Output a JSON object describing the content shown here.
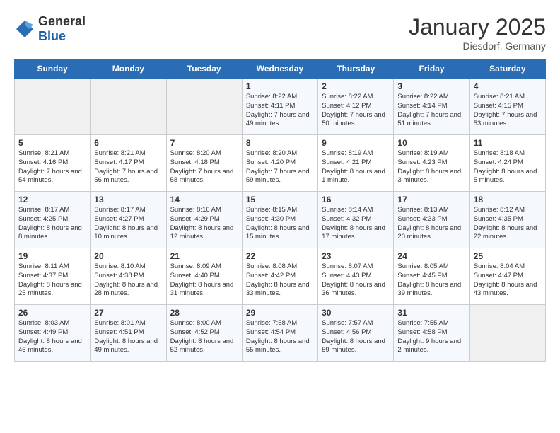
{
  "header": {
    "logo_general": "General",
    "logo_blue": "Blue",
    "title": "January 2025",
    "subtitle": "Diesdorf, Germany"
  },
  "days_of_week": [
    "Sunday",
    "Monday",
    "Tuesday",
    "Wednesday",
    "Thursday",
    "Friday",
    "Saturday"
  ],
  "weeks": [
    [
      {
        "day": "",
        "content": ""
      },
      {
        "day": "",
        "content": ""
      },
      {
        "day": "",
        "content": ""
      },
      {
        "day": "1",
        "content": "Sunrise: 8:22 AM\nSunset: 4:11 PM\nDaylight: 7 hours and 49 minutes."
      },
      {
        "day": "2",
        "content": "Sunrise: 8:22 AM\nSunset: 4:12 PM\nDaylight: 7 hours and 50 minutes."
      },
      {
        "day": "3",
        "content": "Sunrise: 8:22 AM\nSunset: 4:14 PM\nDaylight: 7 hours and 51 minutes."
      },
      {
        "day": "4",
        "content": "Sunrise: 8:21 AM\nSunset: 4:15 PM\nDaylight: 7 hours and 53 minutes."
      }
    ],
    [
      {
        "day": "5",
        "content": "Sunrise: 8:21 AM\nSunset: 4:16 PM\nDaylight: 7 hours and 54 minutes."
      },
      {
        "day": "6",
        "content": "Sunrise: 8:21 AM\nSunset: 4:17 PM\nDaylight: 7 hours and 56 minutes."
      },
      {
        "day": "7",
        "content": "Sunrise: 8:20 AM\nSunset: 4:18 PM\nDaylight: 7 hours and 58 minutes."
      },
      {
        "day": "8",
        "content": "Sunrise: 8:20 AM\nSunset: 4:20 PM\nDaylight: 7 hours and 59 minutes."
      },
      {
        "day": "9",
        "content": "Sunrise: 8:19 AM\nSunset: 4:21 PM\nDaylight: 8 hours and 1 minute."
      },
      {
        "day": "10",
        "content": "Sunrise: 8:19 AM\nSunset: 4:23 PM\nDaylight: 8 hours and 3 minutes."
      },
      {
        "day": "11",
        "content": "Sunrise: 8:18 AM\nSunset: 4:24 PM\nDaylight: 8 hours and 5 minutes."
      }
    ],
    [
      {
        "day": "12",
        "content": "Sunrise: 8:17 AM\nSunset: 4:25 PM\nDaylight: 8 hours and 8 minutes."
      },
      {
        "day": "13",
        "content": "Sunrise: 8:17 AM\nSunset: 4:27 PM\nDaylight: 8 hours and 10 minutes."
      },
      {
        "day": "14",
        "content": "Sunrise: 8:16 AM\nSunset: 4:29 PM\nDaylight: 8 hours and 12 minutes."
      },
      {
        "day": "15",
        "content": "Sunrise: 8:15 AM\nSunset: 4:30 PM\nDaylight: 8 hours and 15 minutes."
      },
      {
        "day": "16",
        "content": "Sunrise: 8:14 AM\nSunset: 4:32 PM\nDaylight: 8 hours and 17 minutes."
      },
      {
        "day": "17",
        "content": "Sunrise: 8:13 AM\nSunset: 4:33 PM\nDaylight: 8 hours and 20 minutes."
      },
      {
        "day": "18",
        "content": "Sunrise: 8:12 AM\nSunset: 4:35 PM\nDaylight: 8 hours and 22 minutes."
      }
    ],
    [
      {
        "day": "19",
        "content": "Sunrise: 8:11 AM\nSunset: 4:37 PM\nDaylight: 8 hours and 25 minutes."
      },
      {
        "day": "20",
        "content": "Sunrise: 8:10 AM\nSunset: 4:38 PM\nDaylight: 8 hours and 28 minutes."
      },
      {
        "day": "21",
        "content": "Sunrise: 8:09 AM\nSunset: 4:40 PM\nDaylight: 8 hours and 31 minutes."
      },
      {
        "day": "22",
        "content": "Sunrise: 8:08 AM\nSunset: 4:42 PM\nDaylight: 8 hours and 33 minutes."
      },
      {
        "day": "23",
        "content": "Sunrise: 8:07 AM\nSunset: 4:43 PM\nDaylight: 8 hours and 36 minutes."
      },
      {
        "day": "24",
        "content": "Sunrise: 8:05 AM\nSunset: 4:45 PM\nDaylight: 8 hours and 39 minutes."
      },
      {
        "day": "25",
        "content": "Sunrise: 8:04 AM\nSunset: 4:47 PM\nDaylight: 8 hours and 43 minutes."
      }
    ],
    [
      {
        "day": "26",
        "content": "Sunrise: 8:03 AM\nSunset: 4:49 PM\nDaylight: 8 hours and 46 minutes."
      },
      {
        "day": "27",
        "content": "Sunrise: 8:01 AM\nSunset: 4:51 PM\nDaylight: 8 hours and 49 minutes."
      },
      {
        "day": "28",
        "content": "Sunrise: 8:00 AM\nSunset: 4:52 PM\nDaylight: 8 hours and 52 minutes."
      },
      {
        "day": "29",
        "content": "Sunrise: 7:58 AM\nSunset: 4:54 PM\nDaylight: 8 hours and 55 minutes."
      },
      {
        "day": "30",
        "content": "Sunrise: 7:57 AM\nSunset: 4:56 PM\nDaylight: 8 hours and 59 minutes."
      },
      {
        "day": "31",
        "content": "Sunrise: 7:55 AM\nSunset: 4:58 PM\nDaylight: 9 hours and 2 minutes."
      },
      {
        "day": "",
        "content": ""
      }
    ]
  ]
}
